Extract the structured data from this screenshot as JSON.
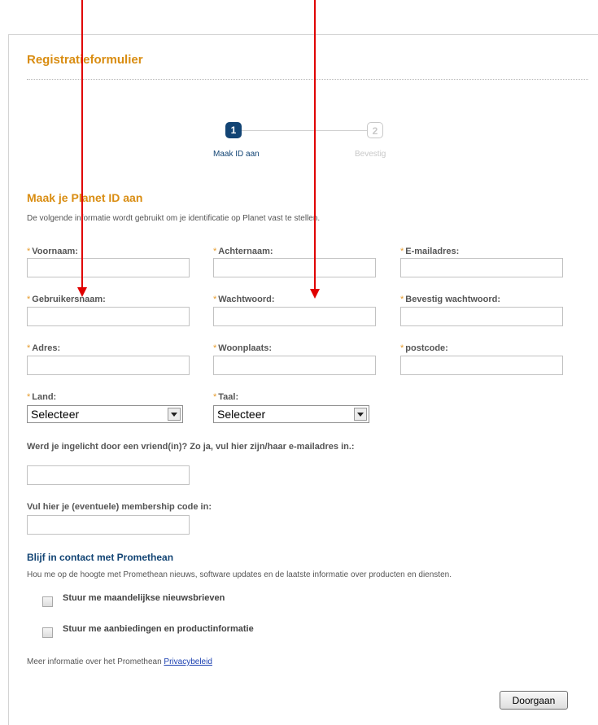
{
  "form": {
    "title": "Registratieformulier"
  },
  "steps": [
    {
      "number": "1",
      "label": "Maak ID aan"
    },
    {
      "number": "2",
      "label": "Bevestig"
    }
  ],
  "section": {
    "heading": "Maak je Planet ID aan",
    "description": "De volgende informatie wordt gebruikt om je identificatie op Planet vast te stellen."
  },
  "required_marker": "*",
  "fields": {
    "voornaam": {
      "label": "Voornaam:",
      "value": ""
    },
    "achternaam": {
      "label": "Achternaam:",
      "value": ""
    },
    "email": {
      "label": "E-mailadres:",
      "value": ""
    },
    "gebruikersnaam": {
      "label": "Gebruikersnaam:",
      "value": ""
    },
    "wachtwoord": {
      "label": "Wachtwoord:",
      "value": ""
    },
    "bevestig_wachtwoord": {
      "label": "Bevestig wachtwoord:",
      "value": ""
    },
    "adres": {
      "label": "Adres:",
      "value": ""
    },
    "woonplaats": {
      "label": "Woonplaats:",
      "value": ""
    },
    "postcode": {
      "label": "postcode:",
      "value": ""
    },
    "land": {
      "label": "Land:",
      "selected": "Selecteer"
    },
    "taal": {
      "label": "Taal:",
      "selected": "Selecteer"
    },
    "vriend_email": {
      "label": "Werd je ingelicht door een vriend(in)? Zo ja, vul hier zijn/haar e-mailadres in.:",
      "value": ""
    },
    "membership_code": {
      "label": "Vul hier je (eventuele) membership code in:",
      "value": ""
    }
  },
  "contact": {
    "heading": "Blijf in contact met Promethean",
    "description": "Hou me op de hoogte met Promethean nieuws, software updates en de laatste informatie over producten en diensten.",
    "options": [
      {
        "label": "Stuur me maandelijkse nieuwsbrieven",
        "checked": false
      },
      {
        "label": "Stuur me aanbiedingen en productinformatie",
        "checked": false
      }
    ]
  },
  "privacy": {
    "text": "Meer informatie over het Promethean ",
    "link": "Privacybeleid"
  },
  "submit": {
    "label": "Doorgaan"
  },
  "colors": {
    "accent": "#d98d12",
    "navy": "#124474",
    "annotation": "#e00000"
  }
}
